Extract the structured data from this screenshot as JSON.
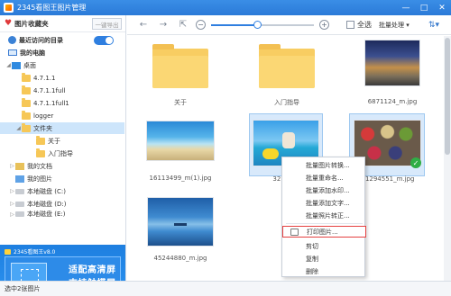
{
  "window": {
    "title": "2345看图王图片管理",
    "min": "—",
    "max": "□",
    "close": "✕"
  },
  "sidebar": {
    "favorites_label": "图片收藏夹",
    "export_label": "一键导出",
    "tree": [
      {
        "label": "最近访问的目录",
        "icon": "clock-icon"
      },
      {
        "label": "我的电脑",
        "icon": "computer-icon"
      },
      {
        "label": "桌面",
        "icon": "desktop-icon"
      },
      {
        "label": "4.7.1.1",
        "icon": "folder-icon"
      },
      {
        "label": "4.7.1.1full",
        "icon": "folder-icon"
      },
      {
        "label": "4.7.1.1full1",
        "icon": "folder-icon"
      },
      {
        "label": "logger",
        "icon": "folder-icon"
      },
      {
        "label": "文件夹",
        "icon": "folder-icon"
      },
      {
        "label": "关于",
        "icon": "folder-icon"
      },
      {
        "label": "入门指导",
        "icon": "folder-icon"
      },
      {
        "label": "我的文档",
        "icon": "document-icon"
      },
      {
        "label": "我的图片",
        "icon": "picture-icon"
      },
      {
        "label": "本地磁盘 (C:)",
        "icon": "drive-icon"
      },
      {
        "label": "本地磁盘 (D:)",
        "icon": "drive-icon"
      },
      {
        "label": "本地磁盘 (E:)",
        "icon": "drive-icon"
      }
    ],
    "banner": {
      "title": "2345看图王v8.0",
      "line1": "适配高清屏",
      "line2": "支持触摸屏"
    }
  },
  "toolbar": {
    "select_all": "全选",
    "batch": "批量处理",
    "zoom_percent": 45
  },
  "items": [
    {
      "name": "关于",
      "type": "folder"
    },
    {
      "name": "入门指导",
      "type": "folder"
    },
    {
      "name": "6871124_m.jpg",
      "type": "image"
    },
    {
      "name": "16113499_m(1).jpg",
      "type": "image"
    },
    {
      "name": "3276007",
      "type": "image"
    },
    {
      "name": "41294551_m.jpg",
      "type": "image"
    },
    {
      "name": "45244880_m.jpg",
      "type": "image"
    }
  ],
  "context_menu": [
    "批量图片转换...",
    "批量重命名...",
    "批量添加水印...",
    "批量添加文字...",
    "批量照片转正...",
    "打印图片...",
    "剪切",
    "复制",
    "删除"
  ],
  "status": {
    "text": "选中2张图片"
  },
  "colors": {
    "accent": "#2f7fe0",
    "selection": "#d8e9fb",
    "highlight_border": "#e54040"
  }
}
